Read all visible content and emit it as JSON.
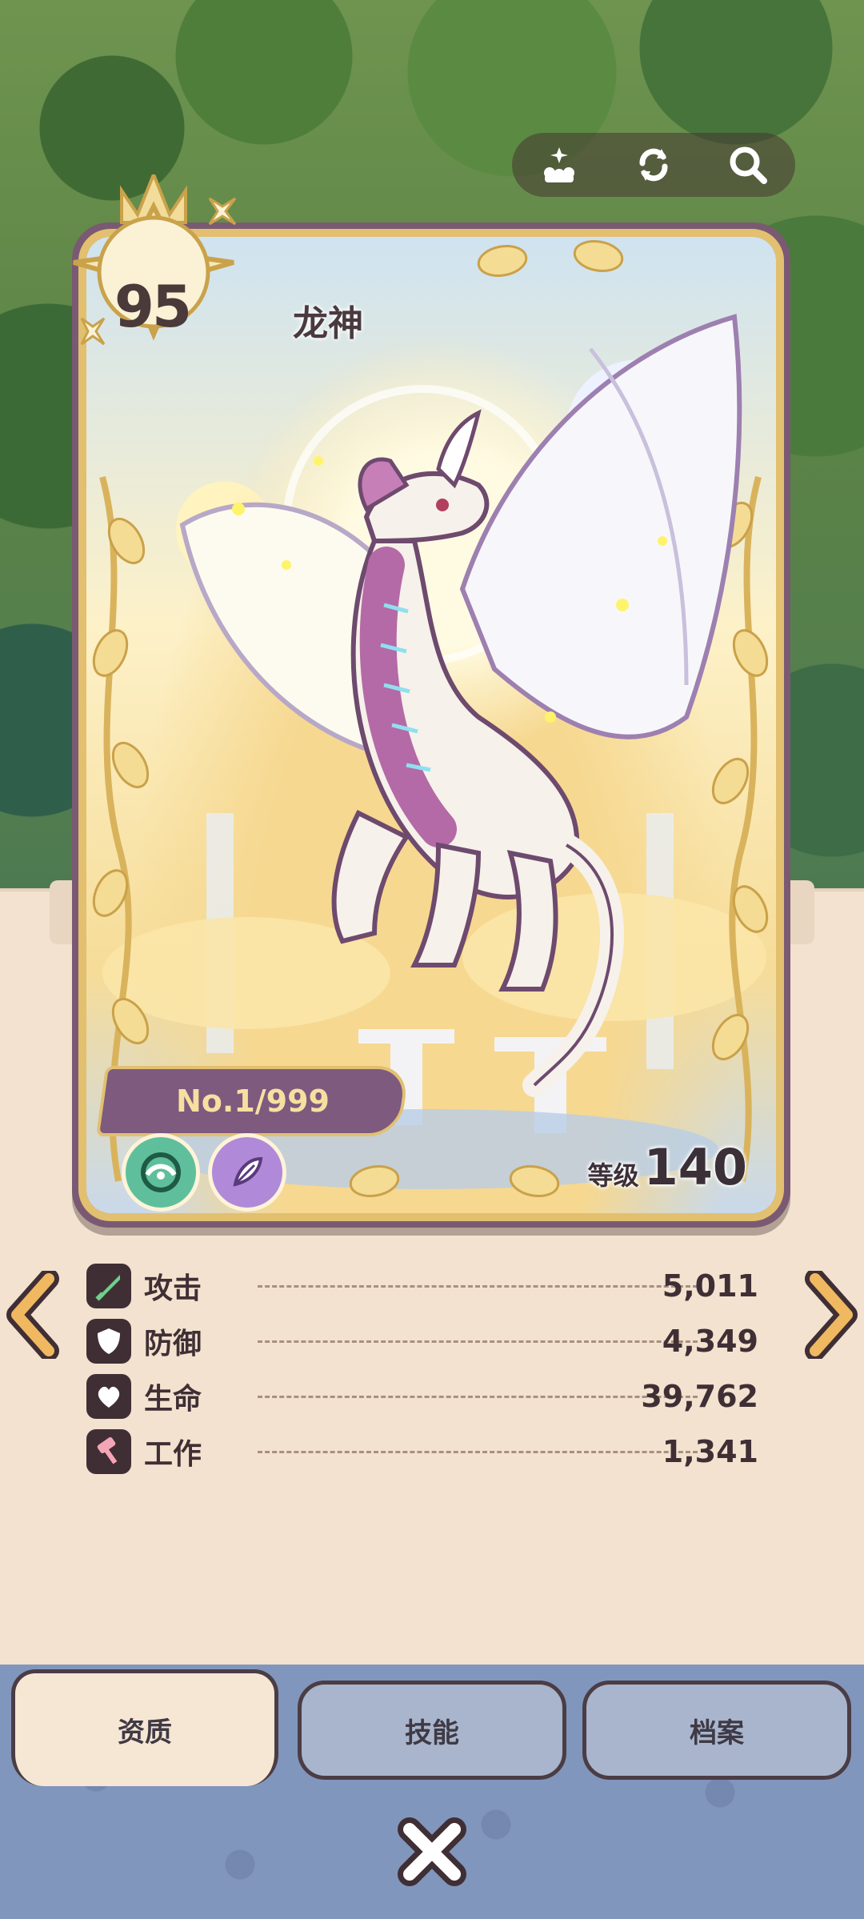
{
  "toolbar": {
    "icons": [
      "sparkle-stack-icon",
      "refresh-icon",
      "search-icon"
    ]
  },
  "card": {
    "level": "95",
    "name": "龙神",
    "serial": "No.1/999",
    "grade_label": "等级",
    "grade_value": "140",
    "elements": [
      "wind-element-icon",
      "feather-element-icon"
    ]
  },
  "stats": [
    {
      "icon": "sword-icon",
      "label": "攻击",
      "value": "5,011"
    },
    {
      "icon": "shield-icon",
      "label": "防御",
      "value": "4,349"
    },
    {
      "icon": "heart-icon",
      "label": "生命",
      "value": "39,762"
    },
    {
      "icon": "hammer-icon",
      "label": "工作",
      "value": "1,341"
    }
  ],
  "tabs": [
    {
      "label": "资质",
      "active": true
    },
    {
      "label": "技能",
      "active": false
    },
    {
      "label": "档案",
      "active": false
    }
  ],
  "colors": {
    "card_border": "#e2c070",
    "card_plate": "#7d5a7e",
    "panel": "#f3e2cf",
    "tab_bar": "#8196bd",
    "arrow": "#f0b860"
  }
}
